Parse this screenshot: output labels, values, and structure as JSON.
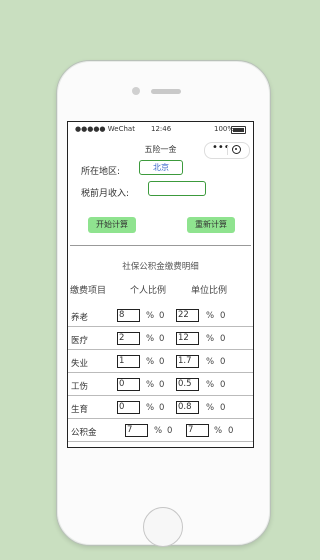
{
  "status": {
    "carrier": "●●●●● WeChat",
    "time": "12:46",
    "battery": "100%"
  },
  "nav": {
    "title": "五险一金",
    "menu_dots": "•••"
  },
  "form": {
    "region_label": "所在地区:",
    "region_value": "北京",
    "income_label": "税前月收入:",
    "income_value": ""
  },
  "buttons": {
    "start": "开始计算",
    "reset": "重新计算"
  },
  "table": {
    "title": "社保公积金缴费明细",
    "headers": {
      "item": "缴费项目",
      "personal": "个人比例",
      "company": "单位比例"
    },
    "rows": [
      {
        "name": "养老",
        "personal": "8",
        "personal_amount": "0",
        "company": "22",
        "company_amount": "0"
      },
      {
        "name": "医疗",
        "personal": "2",
        "personal_amount": "0",
        "company": "12",
        "company_amount": "0"
      },
      {
        "name": "失业",
        "personal": "1",
        "personal_amount": "0",
        "company": "1.7",
        "company_amount": "0"
      },
      {
        "name": "工伤",
        "personal": "0",
        "personal_amount": "0",
        "company": "0.5",
        "company_amount": "0"
      },
      {
        "name": "生育",
        "personal": "0",
        "personal_amount": "0",
        "company": "0.8",
        "company_amount": "0"
      },
      {
        "name": "公积金",
        "personal": "7",
        "personal_amount": "0",
        "company": "7",
        "company_amount": "0"
      }
    ],
    "percent_sign": "%"
  },
  "colors": {
    "accent_green": "#8fe38f",
    "field_border": "#3c9a3c",
    "link_blue": "#3563c9",
    "page_bg": "#c9dfc0"
  }
}
